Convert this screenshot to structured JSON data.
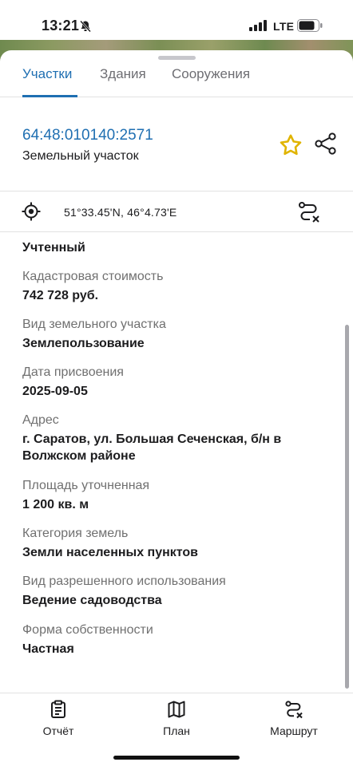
{
  "status_bar": {
    "time": "13:21",
    "network": "LTE"
  },
  "tabs": [
    {
      "label": "Участки",
      "active": true
    },
    {
      "label": "Здания",
      "active": false
    },
    {
      "label": "Сооружения",
      "active": false
    }
  ],
  "parcel": {
    "number": "64:48:010140:2571",
    "type": "Земельный участок"
  },
  "coordinates": "51°33.45'N, 46°4.73'E",
  "details": [
    {
      "label": "Кадастровая стоимость",
      "value": "742 728 руб."
    },
    {
      "label": "Вид земельного участка",
      "value": "Землепользование"
    },
    {
      "label": "Дата присвоения",
      "value": "2025-09-05"
    },
    {
      "label": "Адрес",
      "value": "г. Саратов, ул. Большая Сеченская, б/н в Волжском районе"
    },
    {
      "label": "Площадь уточненная",
      "value": "1 200 кв. м"
    },
    {
      "label": "Категория земель",
      "value": "Земли населенных пунктов"
    },
    {
      "label": "Вид разрешенного использования",
      "value": "Ведение садоводства"
    },
    {
      "label": "Форма собственности",
      "value": "Частная"
    }
  ],
  "status_value": "Учтенный",
  "bottom_nav": [
    {
      "label": "Отчёт",
      "icon": "report-icon"
    },
    {
      "label": "План",
      "icon": "map-icon"
    },
    {
      "label": "Маршрут",
      "icon": "route-icon"
    }
  ],
  "colors": {
    "accent": "#1f6fb2",
    "star": "#e0b400"
  }
}
